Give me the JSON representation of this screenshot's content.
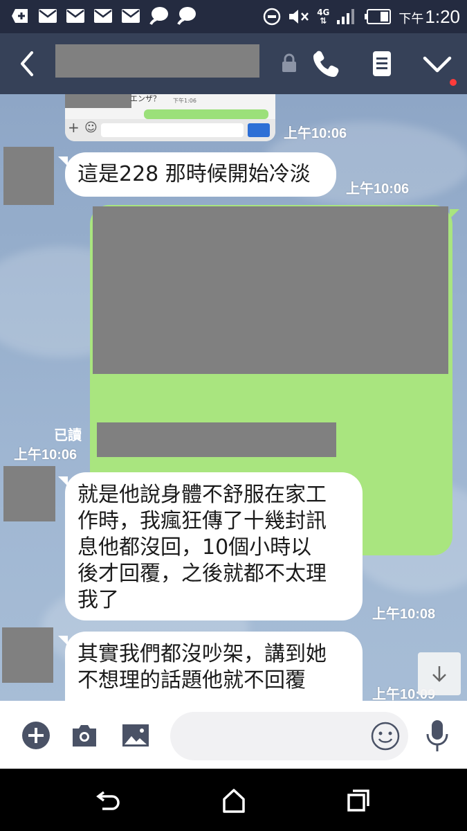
{
  "status_bar": {
    "ampm": "下午",
    "time": "1:20",
    "network": "4G",
    "icons": [
      "add-icon",
      "mail-icon",
      "mail-icon",
      "mail-icon",
      "mail-icon",
      "chat-bubble-icon",
      "chat-bubble-icon",
      "do-not-disturb-icon",
      "mute-icon",
      "signal-icon",
      "battery-icon"
    ]
  },
  "header": {
    "icons": [
      "back-arrow-icon",
      "lock-icon",
      "phone-icon",
      "notes-icon",
      "chevron-down-icon"
    ]
  },
  "messages": {
    "thumb_jp": "エンザ？",
    "thumb_tiny": "下午1:06",
    "ts0": "上午10:06",
    "msg1": "這是228 那時候開始冷淡",
    "ts1": "上午10:06",
    "read": "已讀",
    "ts2": "上午10:06",
    "msg3": "就是他說身體不舒服在家工\n作時，我瘋狂傳了十幾封訊\n息他都沒回，10個小時以\n後才回覆，之後就都不太理\n我了",
    "ts3": "上午10:08",
    "msg4": "其實我們都沒吵架，講到她\n不想理的話題他就不回覆",
    "ts4": "上午10:09"
  },
  "composer": {
    "input_value": "",
    "icons": [
      "plus-circle-icon",
      "camera-icon",
      "image-icon",
      "emoji-icon",
      "microphone-icon"
    ]
  },
  "navbar": {
    "icons": [
      "back-nav-icon",
      "home-icon",
      "recents-icon"
    ]
  },
  "colors": {
    "status_bar": "#242b40",
    "header": "#364158",
    "outgoing_bubble": "#a9e57f",
    "incoming_bubble": "#ffffff",
    "chat_background": "#98b0cd"
  }
}
